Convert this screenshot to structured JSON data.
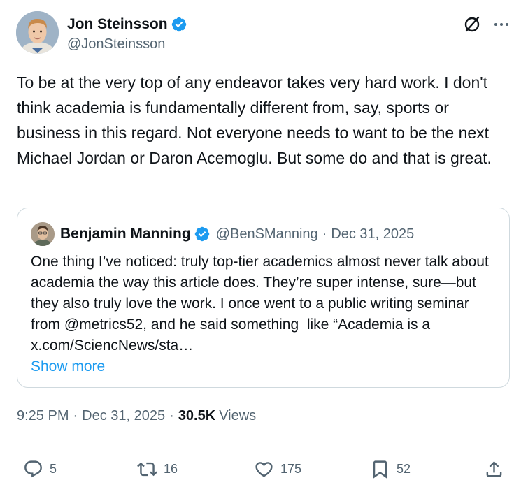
{
  "author": {
    "name": "Jon Steinsson",
    "handle": "@JonSteinsson"
  },
  "tweet": {
    "text": "To be at the very top of any endeavor takes very hard work. I don't think academia is fundamentally different from, say, sports or business in this regard. Not everyone needs to want to be the next Michael Jordan or Daron Acemoglu. But some do and that is great."
  },
  "quote": {
    "name": "Benjamin Manning",
    "handle": "@BenSManning",
    "separator": "·",
    "date": "Dec 31, 2025",
    "text": "One thing I’ve noticed: truly top-tier academics almost never talk about academia the way this article does. They’re super intense, sure—but they also truly love the work. I once went to a public writing seminar from @metrics52, and he said something  like “Academia is a x.com/SciencNews/sta…",
    "show_more": "Show more"
  },
  "meta": {
    "time": "9:25 PM",
    "separator": "·",
    "date": "Dec 31, 2025",
    "views_count": "30.5K",
    "views_label": "Views"
  },
  "actions": {
    "replies": "5",
    "reposts": "16",
    "likes": "175",
    "bookmarks": "52"
  },
  "icons": {
    "verified": "verified-badge-icon",
    "grok": "grok-icon",
    "more": "more-icon",
    "reply": "reply-icon",
    "repost": "repost-icon",
    "like": "heart-icon",
    "bookmark": "bookmark-icon",
    "share": "share-icon"
  },
  "colors": {
    "verified": "#1d9bf0",
    "link": "#1d9bf0",
    "secondary_text": "#536471",
    "primary_text": "#0f1419",
    "border": "#cfd9de"
  }
}
